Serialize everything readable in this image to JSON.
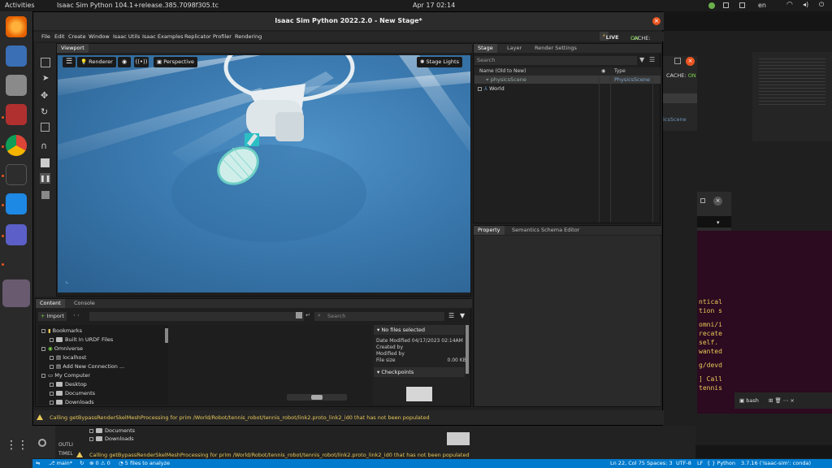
{
  "topbar": {
    "activities": "Activities",
    "app_title": "Isaac Sim Python 104.1+release.385.7098f305.tc",
    "clock": "Apr 17  02:14",
    "lang": "en"
  },
  "window": {
    "title": "Isaac Sim Python 2022.2.0 - New Stage*"
  },
  "menu": [
    "File",
    "Edit",
    "Create",
    "Window",
    "Isaac Utils",
    "Isaac Examples",
    "Replicator",
    "Profiler",
    "Rendering"
  ],
  "live": {
    "label": "LIVE",
    "cache_label": "CACHE:",
    "cache_state": "ON"
  },
  "viewport": {
    "tab": "Viewport",
    "renderer": "Renderer",
    "perspective": "Perspective",
    "stage_lights": "Stage Lights"
  },
  "stage": {
    "tabs": [
      "Stage",
      "Layer",
      "Render Settings"
    ],
    "search_placeholder": "Search",
    "col_name": "Name (Old to New)",
    "col_type": "Type",
    "rows": [
      {
        "name": "physicsScene",
        "type": "PhysicsScene"
      },
      {
        "name": "World",
        "type": ""
      }
    ]
  },
  "property": {
    "tabs": [
      "Property",
      "Semantics Schema Editor"
    ]
  },
  "content": {
    "tabs": [
      "Content",
      "Console"
    ],
    "import_label": "Import",
    "search_placeholder": "Search",
    "tree": [
      "Bookmarks",
      "Built In URDF Files",
      "Omniverse",
      "localhost",
      "Add New Connection ...",
      "My Computer",
      "Desktop",
      "Documents",
      "Downloads"
    ],
    "info": {
      "header": "No files selected",
      "date_label": "Date Modified",
      "date_value": "04/17/2023 02:14AM",
      "created_by": "Created by",
      "modified_by": "Modified by",
      "file_size": "File size",
      "file_size_value": "0.00 KB",
      "checkpoints": "Checkpoints"
    }
  },
  "status_msg": "Calling getBypassRenderSkelMeshProcessing for prim /World/Robot/tennis_robot/tennis_robot/link2.proto_link2_id0 that has not been populated",
  "behind": {
    "cache_label": "CACHE:",
    "cache_state": "ON",
    "scene_label": "icsScene",
    "terminal_lines": [
      "ntical",
      "tion s",
      "omni/i",
      "recate",
      "self.",
      "wanted",
      "g/devd",
      "] Call",
      "tennis"
    ],
    "bash": "bash",
    "tree": [
      "Documents",
      "Downloads"
    ],
    "outline": "OUTLI",
    "timeline": "TIMEL"
  },
  "vscode_status": {
    "branch": "main*",
    "errors": "0",
    "warnings": "0",
    "analyze": "5 files to analyze",
    "position": "Ln 22, Col 75",
    "spaces": "Spaces: 3",
    "encoding": "UTF-8",
    "eol": "LF",
    "language": "Python",
    "interpreter": "3.7.16 ('isaac-sim': conda)"
  },
  "colors": {
    "accent": "#e95420",
    "viewport_floor": "#3b7ab0",
    "warning": "#e8c85a",
    "vscode_blue": "#007acc",
    "live": "#f2c94c",
    "cache_on": "#7cd34c"
  }
}
